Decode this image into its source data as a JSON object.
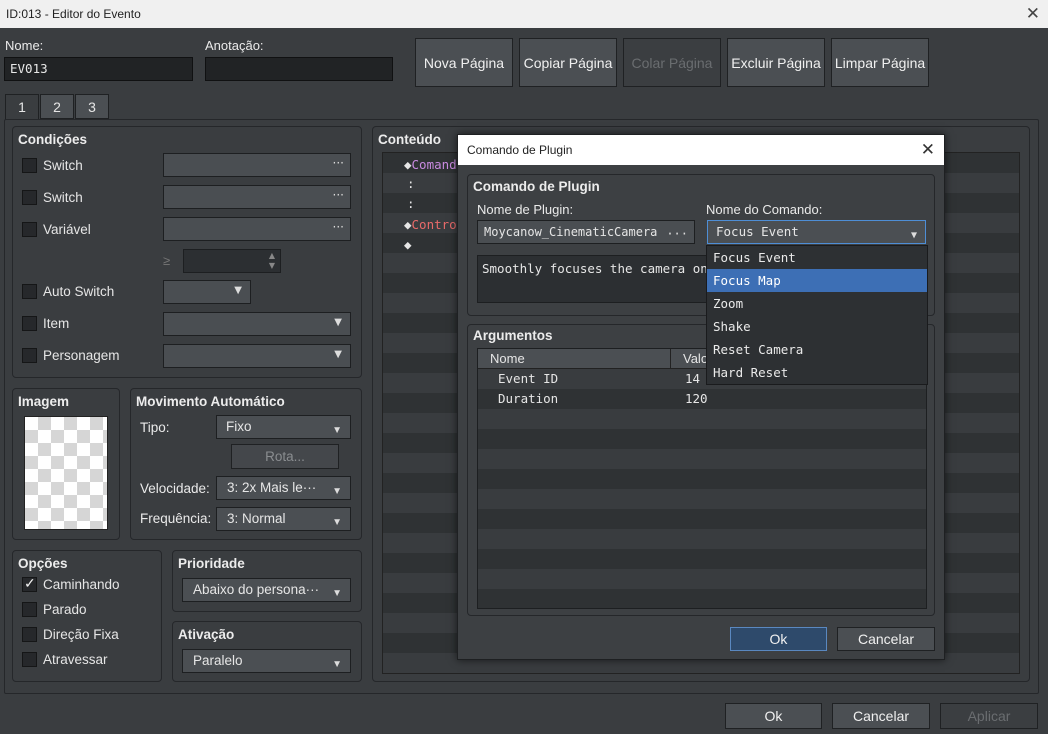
{
  "window": {
    "title": "ID:013 - Editor do Evento",
    "close": "✕"
  },
  "header": {
    "name_label": "Nome:",
    "name_value": "EV013",
    "note_label": "Anotação:",
    "note_value": "",
    "buttons": [
      {
        "label": "Nova Página",
        "enabled": true
      },
      {
        "label": "Copiar Página",
        "enabled": true
      },
      {
        "label": "Colar Página",
        "enabled": false
      },
      {
        "label": "Excluir Página",
        "enabled": true
      },
      {
        "label": "Limpar Página",
        "enabled": true
      }
    ]
  },
  "tabs": [
    "1",
    "2",
    "3"
  ],
  "conditions": {
    "title": "Condições",
    "switch1": "Switch",
    "switch2": "Switch",
    "variable": "Variável",
    "ge": "≥",
    "self_switch": "Auto Switch",
    "item": "Item",
    "actor": "Personagem"
  },
  "image": {
    "title": "Imagem"
  },
  "autonomous": {
    "title": "Movimento Automático",
    "type_label": "Tipo:",
    "type_value": "Fixo",
    "route_button": "Rota...",
    "speed_label": "Velocidade:",
    "speed_value": "3: 2x Mais le···",
    "freq_label": "Frequência:",
    "freq_value": "3: Normal"
  },
  "options": {
    "title": "Opções",
    "walking": "Caminhando",
    "walking_checked": true,
    "stepping": "Parado",
    "direction_fix": "Direção Fixa",
    "through": "Atravessar"
  },
  "priority": {
    "title": "Prioridade",
    "value": "Abaixo do persona···"
  },
  "trigger": {
    "title": "Ativação",
    "value": "Paralelo"
  },
  "contents": {
    "title": "Conteúdo",
    "lines": [
      {
        "prefix": "◆",
        "text": "Comand"
      },
      {
        "prefix": "",
        "text": ":"
      },
      {
        "prefix": "",
        "text": ":"
      },
      {
        "prefix": "◆",
        "text": "Contro"
      },
      {
        "prefix": "◆",
        "text": ""
      }
    ]
  },
  "footer": {
    "ok": "Ok",
    "cancel": "Cancelar",
    "apply": "Aplicar"
  },
  "dialog": {
    "title": "Comando de Plugin",
    "group_title": "Comando de Plugin",
    "plugin_label": "Nome de Plugin:",
    "plugin_value": "Moycanow_CinematicCamera",
    "command_label": "Nome do Comando:",
    "command_value": "Focus Event",
    "description": "Smoothly focuses the camera on an",
    "args_title": "Argumentos",
    "col_name": "Nome",
    "col_value": "Valo",
    "args": [
      {
        "name": "Event ID",
        "value": "14"
      },
      {
        "name": "Duration",
        "value": "120"
      }
    ],
    "ok": "Ok",
    "cancel": "Cancelar",
    "dropdown_options": [
      "Focus Event",
      "Focus Map",
      "Zoom",
      "Shake",
      "Reset Camera",
      "Hard Reset"
    ],
    "dropdown_selected": "Focus Map"
  },
  "icons": {
    "dots": "···",
    "arrow": "▼",
    "check": "✓",
    "diamond": "◆"
  }
}
